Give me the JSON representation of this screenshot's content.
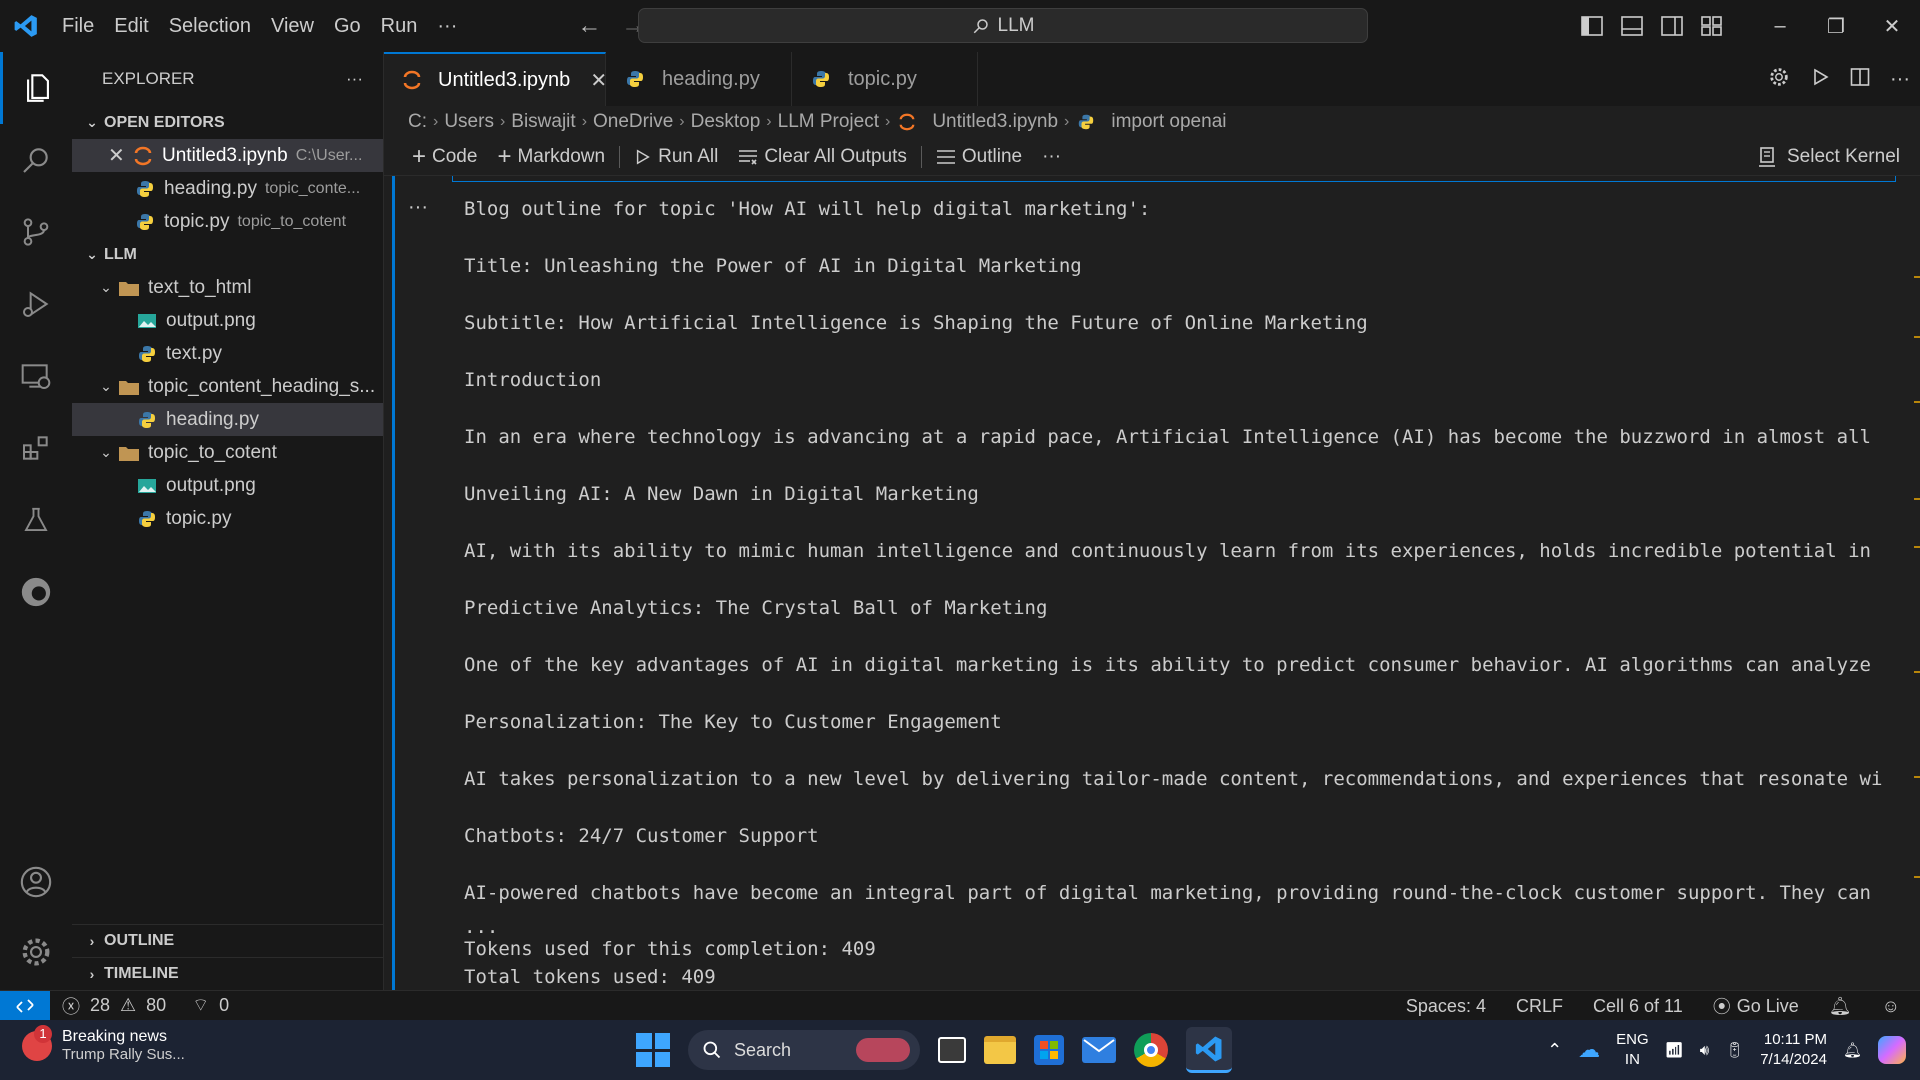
{
  "titlebar": {
    "menu": [
      "File",
      "Edit",
      "Selection",
      "View",
      "Go",
      "Run",
      "···"
    ],
    "search": "LLM"
  },
  "sidebar": {
    "title": "EXPLORER",
    "open_editors_label": "OPEN EDITORS",
    "open_editors": [
      {
        "name": "Untitled3.ipynb",
        "path": "C:\\User..."
      },
      {
        "name": "heading.py",
        "path": "topic_conte..."
      },
      {
        "name": "topic.py",
        "path": "topic_to_cotent"
      }
    ],
    "folder_label": "LLM",
    "tree": [
      {
        "label": "text_to_html"
      },
      {
        "label": "output.png"
      },
      {
        "label": "text.py"
      },
      {
        "label": "topic_content_heading_s..."
      },
      {
        "label": "heading.py"
      },
      {
        "label": "topic_to_cotent"
      },
      {
        "label": "output.png"
      },
      {
        "label": "topic.py"
      }
    ],
    "outline_label": "OUTLINE",
    "timeline_label": "TIMELINE"
  },
  "tabs": [
    {
      "label": "Untitled3.ipynb"
    },
    {
      "label": "heading.py"
    },
    {
      "label": "topic.py"
    }
  ],
  "breadcrumb": [
    "C:",
    "Users",
    "Biswajit",
    "OneDrive",
    "Desktop",
    "LLM Project",
    "Untitled3.ipynb",
    "import openai"
  ],
  "notebook_toolbar": {
    "code": "Code",
    "markdown": "Markdown",
    "run_all": "Run All",
    "clear_outputs": "Clear All Outputs",
    "outline": "Outline",
    "more": "···",
    "kernel": "Select Kernel"
  },
  "output_lines": [
    "Blog outline for topic 'How AI will help digital marketing':",
    "Title: Unleashing the Power of AI in Digital Marketing",
    "Subtitle: How Artificial Intelligence is Shaping the Future of Online Marketing",
    "Introduction",
    "In an era where technology is advancing at a rapid pace, Artificial Intelligence (AI) has become the buzzword in almost all",
    "Unveiling AI: A New Dawn in Digital Marketing",
    "AI, with its ability to mimic human intelligence and continuously learn from its experiences, holds incredible potential in",
    "Predictive Analytics: The Crystal Ball of Marketing",
    "One of the key advantages of AI in digital marketing is its ability to predict consumer behavior. AI algorithms can analyze",
    "Personalization: The Key to Customer Engagement",
    "AI takes personalization to a new level by delivering tailor-made content, recommendations, and experiences that resonate wi",
    "Chatbots: 24/7 Customer Support",
    "AI-powered chatbots have become an integral part of digital marketing, providing round-the-clock customer support. They can",
    "...",
    "Tokens used for this completion: 409",
    "Total tokens used: 409"
  ],
  "statusbar": {
    "errors": "28",
    "warnings": "80",
    "ports": "0",
    "spaces": "Spaces: 4",
    "eol": "CRLF",
    "cell": "Cell 6 of 11",
    "golive": "Go Live"
  },
  "taskbar": {
    "news_badge": "1",
    "news_title": "Breaking news",
    "news_sub": "Trump Rally Sus...",
    "search": "Search",
    "lang1": "ENG",
    "lang2": "IN",
    "time": "10:11 PM",
    "date": "7/14/2024"
  },
  "colors": {
    "accent": "#0078d4",
    "background": "#1f1f1f",
    "sidebar": "#181818",
    "taskbar": "#1c2333"
  }
}
